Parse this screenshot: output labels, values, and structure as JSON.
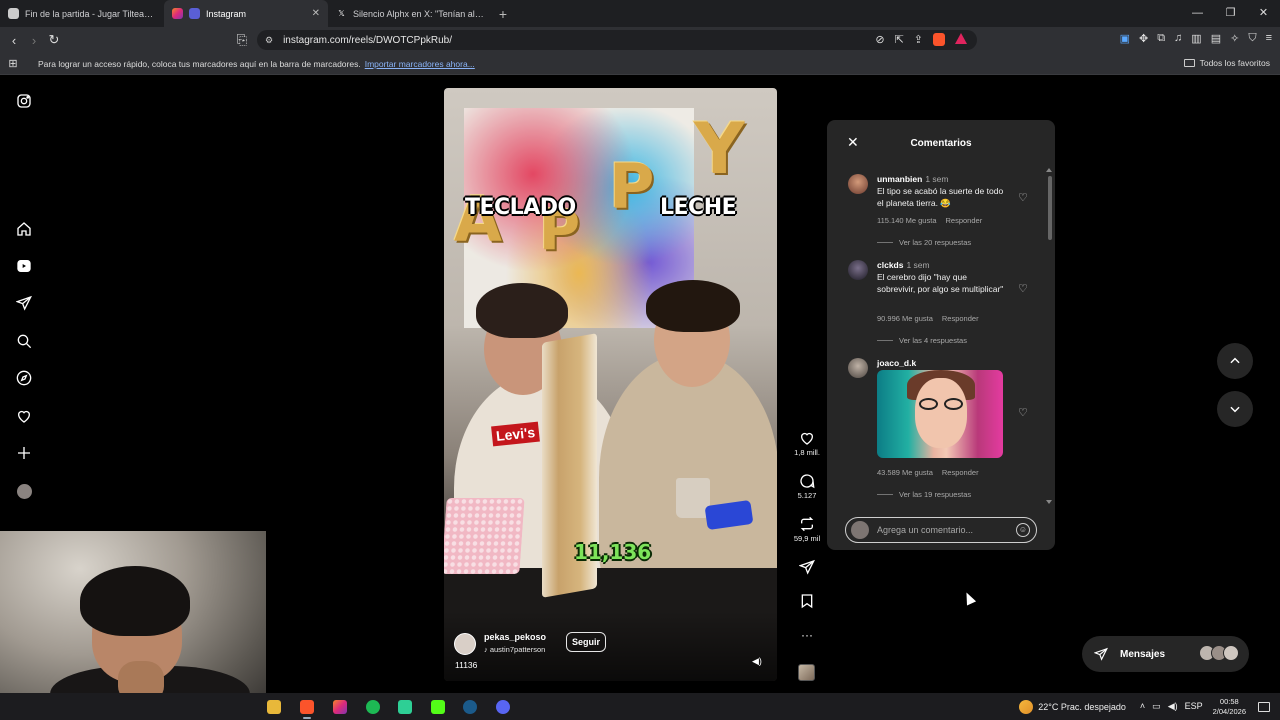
{
  "browser": {
    "tabs": [
      {
        "title": "Fin de la partida - Jugar Tilteadazo -",
        "favicon": "globe-icon",
        "active": false
      },
      {
        "title": "Instagram",
        "favicon": "instagram-icon",
        "active": true
      },
      {
        "title": "Silencio Alphx en X: \"Tenían al homb",
        "favicon": "x-icon",
        "active": false
      }
    ],
    "url": "instagram.com/reels/DWOTCPpkRub/",
    "bookmarks_message": "Para lograr un acceso rápido, coloca tus marcadores aquí en la barra de marcadores.",
    "bookmarks_link": "Importar marcadores ahora...",
    "all_bookmarks": "Todos los favoritos"
  },
  "reel": {
    "overlay_left": "TECLADO",
    "overlay_right": "LECHE",
    "counter": "11,136",
    "balloons": [
      "A",
      "P",
      "P",
      "Y"
    ],
    "shirt_logo": "Levi's",
    "author": "pekas_pekoso",
    "audio": "austin7patterson",
    "follow": "Seguir",
    "caption": "11136",
    "mute_icon": "speaker-icon"
  },
  "actions": {
    "likes": "1,8 mill.",
    "comments": "5.127",
    "reposts": "59,9 mil"
  },
  "comments_panel": {
    "title": "Comentarios",
    "items": [
      {
        "user": "unmanbien",
        "time": "1 sem",
        "text": "El tipo se acabó la suerte de todo el planeta tierra. 😂",
        "likes": "115.140 Me gusta",
        "reply": "Responder",
        "replies": "Ver las 20 respuestas"
      },
      {
        "user": "clckds",
        "time": "1 sem",
        "text": "El cerebro dijo \"hay que sobrevivir, por algo se multiplicar\"",
        "likes": "90.996 Me gusta",
        "reply": "Responder",
        "replies": "Ver las 4 respuestas"
      },
      {
        "user": "joaco_d.k",
        "time": "",
        "text": "",
        "likes": "43.589 Me gusta",
        "reply": "Responder",
        "replies": "Ver las 19 respuestas"
      }
    ],
    "input_placeholder": "Agrega un comentario..."
  },
  "messages": {
    "label": "Mensajes"
  },
  "taskbar": {
    "weather": "22°C  Prac. despejado",
    "language": "ESP",
    "time": "00:58",
    "date": "2/04/2026"
  },
  "colors": {
    "accent_green": "#7de35a",
    "instagram_bg": "#000000",
    "panel_bg": "#262626"
  }
}
